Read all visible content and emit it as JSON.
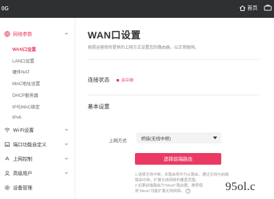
{
  "topbar": {
    "brand": "0G",
    "home_label": "首页",
    "home_icon": "home-icon",
    "tools_icon": "toolbox-icon"
  },
  "sidebar": {
    "items": [
      {
        "label": "网络参数",
        "icon": "globe-icon",
        "expanded": true
      },
      {
        "label": "Wi-Fi设置",
        "icon": "wifi-icon"
      },
      {
        "label": "端口功能自定义",
        "icon": "port-icon"
      },
      {
        "label": "上网控制",
        "icon": "control-icon"
      },
      {
        "label": "高级用户",
        "icon": "user-icon"
      },
      {
        "label": "设备管理",
        "icon": "gear-icon"
      }
    ],
    "sub_items": [
      {
        "label": "WAN口设置",
        "active": true
      },
      {
        "label": "LAN口设置"
      },
      {
        "label": "硬件NAT"
      },
      {
        "label": "MAC地址设置"
      },
      {
        "label": "DHCP服务器"
      },
      {
        "label": "IP与MAC绑定"
      },
      {
        "label": "IPv6"
      }
    ]
  },
  "main": {
    "title": "WAN口设置",
    "description": "按照运营商所提供的上网方式设置您的路由器，以正常联网。",
    "connection_status_label": "连接状态",
    "connection_status_value": "未中继",
    "basic_settings_label": "基本设置",
    "internet_mode_label": "上网方式",
    "internet_mode_value": "桥接(无线中继)",
    "select_router_button": "选择前端路由",
    "note_line1": "1.选择无线中继，本路由将作为从路由，通过无线与前端路由中继，扩展无线网络的覆盖范围。",
    "note_line2": "2.如果前端路由为\"Mesh\"路由器，推荐使用\"Mesh\"功能扩展无线网络。",
    "help_icon": "question-icon"
  },
  "watermark": "95ol.c",
  "colors": {
    "accent": "#ea3a63",
    "topbar": "#2f3032"
  }
}
